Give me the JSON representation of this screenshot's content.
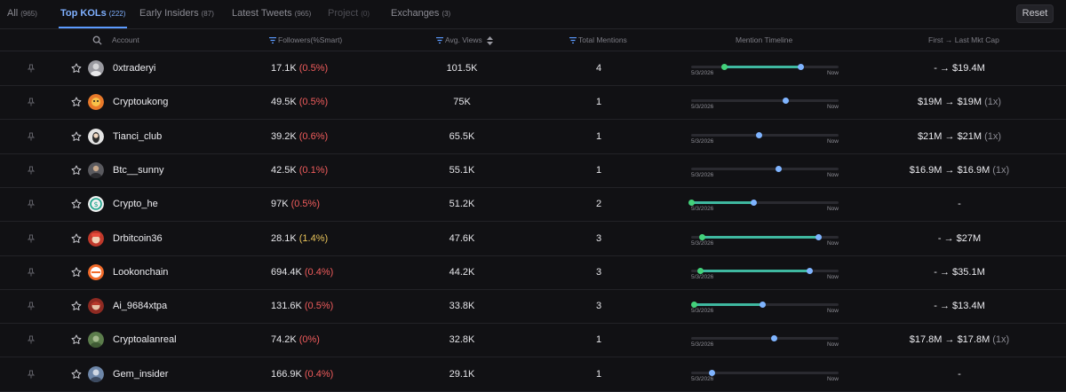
{
  "tabs": [
    {
      "label": "All",
      "count": "(965)"
    },
    {
      "label": "Top KOLs",
      "count": "(222)"
    },
    {
      "label": "Early Insiders",
      "count": "(87)"
    },
    {
      "label": "Latest Tweets",
      "count": "(965)"
    },
    {
      "label": "Project",
      "count": "(0)"
    },
    {
      "label": "Exchanges",
      "count": "(3)"
    }
  ],
  "active_tab": "Top KOLs",
  "reset_label": "Reset",
  "headers": {
    "account": "Account",
    "followers": "Followers(%Smart)",
    "views": "Avg. Views",
    "mentions": "Total Mentions",
    "timeline": "Mention Timeline",
    "mktcap": "First → Last Mkt Cap"
  },
  "timeline_labels": {
    "start": "5/3/2026",
    "end": "Now"
  },
  "colors": {
    "accent": "#5c9bff",
    "pct_red": "#f05c5c",
    "pct_yellow": "#e8c35a",
    "timeline_fill": "#3fb8a0",
    "dot_green": "#43d17a",
    "dot_blue": "#7fb4ff"
  },
  "rows": [
    {
      "name": "0xtraderyi",
      "followers": "17.1K",
      "pct": "(0.5%)",
      "pct_color": "red",
      "views": "101.5K",
      "mentions": "4",
      "mkt": "- → $19.4M",
      "mult": "",
      "timeline": {
        "first": 0.22,
        "last": 0.74
      },
      "avatar": "avatar-grey"
    },
    {
      "name": "Cryptoukong",
      "followers": "49.5K",
      "pct": "(0.5%)",
      "pct_color": "red",
      "views": "75K",
      "mentions": "1",
      "mkt": "$19M → $19M",
      "mult": "(1x)",
      "timeline": {
        "first": null,
        "last": 0.64
      },
      "avatar": "avatar-orange"
    },
    {
      "name": "Tianci_club",
      "followers": "39.2K",
      "pct": "(0.6%)",
      "pct_color": "red",
      "views": "65.5K",
      "mentions": "1",
      "mkt": "$21M → $21M",
      "mult": "(1x)",
      "timeline": {
        "first": null,
        "last": 0.46
      },
      "avatar": "avatar-white"
    },
    {
      "name": "Btc__sunny",
      "followers": "42.5K",
      "pct": "(0.1%)",
      "pct_color": "red",
      "views": "55.1K",
      "mentions": "1",
      "mkt": "$16.9M → $16.9M",
      "mult": "(1x)",
      "timeline": {
        "first": null,
        "last": 0.59
      },
      "avatar": "avatar-dark"
    },
    {
      "name": "Crypto_he",
      "followers": "97K",
      "pct": "(0.5%)",
      "pct_color": "red",
      "views": "51.2K",
      "mentions": "2",
      "mkt": "-",
      "mult": "",
      "timeline": {
        "first": 0.0,
        "last": 0.42
      },
      "avatar": "avatar-teal"
    },
    {
      "name": "Drbitcoin36",
      "followers": "28.1K",
      "pct": "(1.4%)",
      "pct_color": "yellow",
      "views": "47.6K",
      "mentions": "3",
      "mkt": "- → $27M",
      "mult": "",
      "timeline": {
        "first": 0.07,
        "last": 0.86
      },
      "avatar": "avatar-red"
    },
    {
      "name": "Lookonchain",
      "followers": "694.4K",
      "pct": "(0.4%)",
      "pct_color": "red",
      "views": "44.2K",
      "mentions": "3",
      "mkt": "- → $35.1M",
      "mult": "",
      "timeline": {
        "first": 0.06,
        "last": 0.8
      },
      "avatar": "avatar-orange-ring"
    },
    {
      "name": "Ai_9684xtpa",
      "followers": "131.6K",
      "pct": "(0.5%)",
      "pct_color": "red",
      "views": "33.8K",
      "mentions": "3",
      "mkt": "- → $13.4M",
      "mult": "",
      "timeline": {
        "first": 0.02,
        "last": 0.48
      },
      "avatar": "avatar-red-hair"
    },
    {
      "name": "Cryptoalanreal",
      "followers": "74.2K",
      "pct": "(0%)",
      "pct_color": "red",
      "views": "32.8K",
      "mentions": "1",
      "mkt": "$17.8M → $17.8M",
      "mult": "(1x)",
      "timeline": {
        "first": null,
        "last": 0.56
      },
      "avatar": "avatar-green"
    },
    {
      "name": "Gem_insider",
      "followers": "166.9K",
      "pct": "(0.4%)",
      "pct_color": "red",
      "views": "29.1K",
      "mentions": "1",
      "mkt": "-",
      "mult": "",
      "timeline": {
        "first": null,
        "last": 0.14
      },
      "avatar": "avatar-blue"
    }
  ]
}
